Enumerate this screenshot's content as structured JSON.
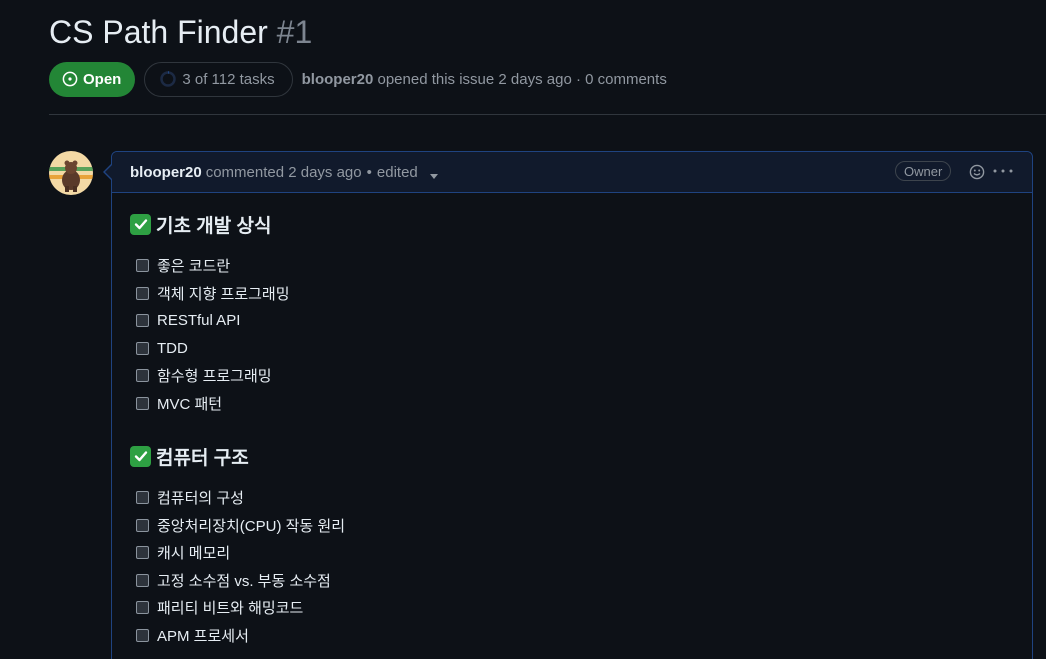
{
  "issue": {
    "title": "CS Path Finder",
    "number": "#1",
    "state": "Open",
    "tasks": "3 of 112 tasks",
    "author": "blooper20",
    "opened_text": "opened this issue 2 days ago · 0 comments"
  },
  "comment": {
    "author": "blooper20",
    "commented": "commented 2 days ago",
    "separator": "•",
    "edited": "edited",
    "owner_badge": "Owner",
    "sections": [
      {
        "heading": "기초 개발 상식",
        "items": [
          "좋은 코드란",
          "객체 지향 프로그래밍",
          "RESTful API",
          "TDD",
          "함수형 프로그래밍",
          "MVC 패턴"
        ]
      },
      {
        "heading": "컴퓨터 구조",
        "items": [
          "컴퓨터의 구성",
          "중앙처리장치(CPU) 작동 원리",
          "캐시 메모리",
          "고정 소수점 vs. 부동 소수점",
          "패리티 비트와 해밍코드",
          "APM 프로세서"
        ]
      }
    ]
  },
  "colors": {
    "background": "#0d1117",
    "open_green": "#238636",
    "comment_border": "#1f4380",
    "check_emoji": "#2ea043"
  },
  "icons": {
    "state": "issue-opened-icon",
    "tasks": "progress-circle-icon",
    "reaction": "smiley-icon",
    "more": "kebab-horizontal-icon",
    "section_check": "white-check-mark-icon"
  }
}
